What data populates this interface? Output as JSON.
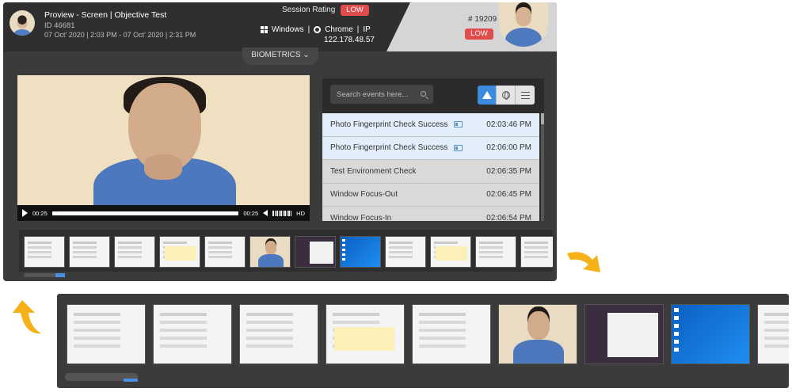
{
  "header": {
    "title": "Proview - Screen | Objective Test",
    "id": "ID 46681",
    "time_range": "07 Oct' 2020 | 2:03 PM - 07 Oct' 2020 | 2:31 PM",
    "session_rating_label": "Session Rating",
    "session_rating_value": "LOW",
    "os": "Windows",
    "browser": "Chrome",
    "ip_label": "IP",
    "ip_value": "122.178.48.57",
    "candidate_number": "# 19209",
    "candidate_rating": "LOW",
    "separator": "|"
  },
  "biometrics": {
    "label": "BIOMETRICS",
    "chevron": "⌄"
  },
  "video": {
    "current_time": "00:25",
    "duration": "00:25",
    "quality": "HD",
    "progress": 1.0
  },
  "events": {
    "search_placeholder": "Search events here...",
    "filters": [
      {
        "name": "warning-icon",
        "active": true
      },
      {
        "name": "globe-icon",
        "active": false
      },
      {
        "name": "sliders-icon",
        "active": false
      }
    ],
    "items": [
      {
        "label": "Photo Fingerprint Check Success",
        "time": "02:03:46 PM",
        "highlight": true,
        "has_id_icon": true
      },
      {
        "label": "Photo Fingerprint Check Success",
        "time": "02:06:00 PM",
        "highlight": true,
        "has_id_icon": true
      },
      {
        "label": "Test Environment Check",
        "time": "02:06:35 PM",
        "highlight": false,
        "has_id_icon": false
      },
      {
        "label": "Window Focus-Out",
        "time": "02:06:45 PM",
        "highlight": false,
        "has_id_icon": false
      },
      {
        "label": "Window Focus-In",
        "time": "02:06:54 PM",
        "highlight": false,
        "has_id_icon": false
      }
    ]
  },
  "thumbnails": [
    "doc",
    "doc",
    "doc",
    "yellow",
    "doc",
    "person",
    "dark",
    "blue",
    "doc",
    "yellow",
    "doc",
    "doc"
  ],
  "strip_thumbnails": [
    "doc",
    "doc",
    "doc",
    "yellow",
    "doc",
    "person",
    "dark",
    "blue",
    "doc"
  ],
  "colors": {
    "accent": "#3d8be0",
    "danger": "#e04b4b",
    "arrow": "#f5b117"
  }
}
